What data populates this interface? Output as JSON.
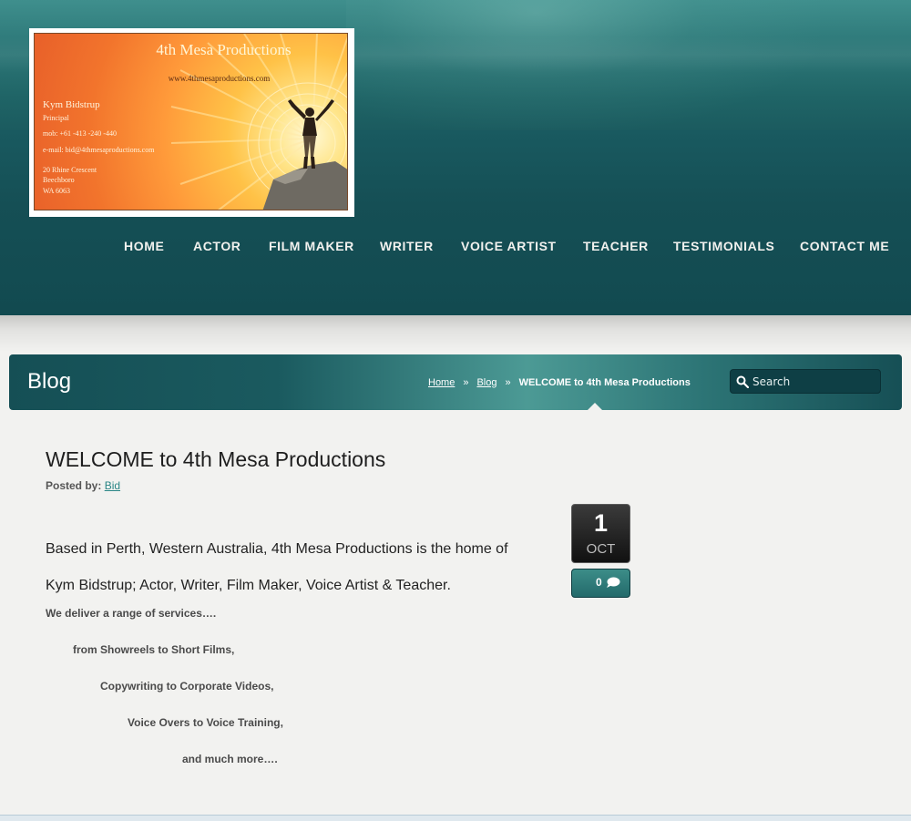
{
  "logo": {
    "title": "4th Mesa Productions",
    "website": "www.4thmesaproductions.com",
    "name": "Kym Bidstrup",
    "role": "Principal",
    "mobile": "mob: +61 -413 -240 -440",
    "email": "e-mail: bid@4thmesaproductions.com",
    "address_line1": "20 Rhine Crescent",
    "address_line2": "Beechboro",
    "address_line3": "WA     6063"
  },
  "nav": {
    "items": [
      "HOME",
      "ACTOR",
      "FILM MAKER",
      "WRITER",
      "VOICE ARTIST",
      "TEACHER",
      "TESTIMONIALS",
      "CONTACT ME"
    ]
  },
  "blogbar": {
    "title": "Blog",
    "breadcrumb": [
      "Home",
      "Blog",
      "WELCOME to 4th Mesa Productions"
    ],
    "separator": "»",
    "search_placeholder": "Search"
  },
  "post": {
    "title": "WELCOME to 4th Mesa Productions",
    "posted_by_label": "Posted by:",
    "author": "Bid",
    "paragraph_line1": "Based in Perth, Western Australia, 4th Mesa Productions is the home of",
    "paragraph_line2": "Kym Bidstrup; Actor, Writer, Film Maker, Voice Artist & Teacher.",
    "services": [
      "We deliver a range of services….",
      "from Showreels to Short Films,",
      "Copywriting to Corporate Videos,",
      "Voice Overs to Voice Training,",
      "and much more…."
    ],
    "date_day": "1",
    "date_month": "OCT",
    "comment_count": "0"
  },
  "colors": {
    "header_dark": "#154f55",
    "header_light": "#3f8f8d",
    "link": "#2a8686",
    "background": "#f2f2f0"
  }
}
